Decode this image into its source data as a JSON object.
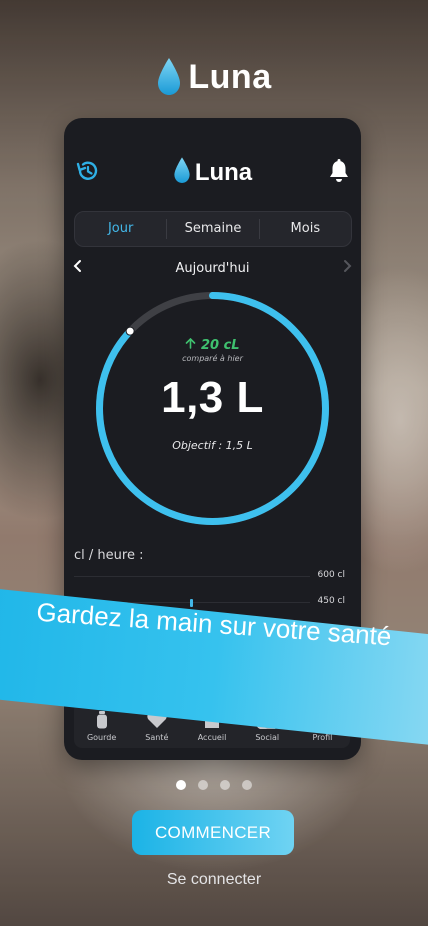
{
  "app": {
    "name": "Luna"
  },
  "preview": {
    "header": {
      "title": "Luna"
    },
    "tabs": [
      {
        "label": "Jour",
        "active": true
      },
      {
        "label": "Semaine",
        "active": false
      },
      {
        "label": "Mois",
        "active": false
      }
    ],
    "date_label": "Aujourd'hui",
    "gauge": {
      "delta": "20 cL",
      "delta_note": "comparé à hier",
      "value": "1,3 L",
      "objective": "Objectif : 1,5 L",
      "progress": 0.87
    },
    "hourly": {
      "title": "cl / heure :",
      "grid_labels": [
        "600 cl",
        "450 cl"
      ]
    },
    "nav": [
      {
        "label": "Gourde",
        "icon": "bottle-icon"
      },
      {
        "label": "Santé",
        "icon": "heart-icon"
      },
      {
        "label": "Accueil",
        "icon": "home-icon"
      },
      {
        "label": "Social",
        "icon": "people-icon"
      },
      {
        "label": "Profil",
        "icon": "profile-icon"
      }
    ]
  },
  "banner": {
    "text": "Gardez la main sur votre santé"
  },
  "pagination": {
    "count": 4,
    "active": 0
  },
  "cta": {
    "label": "COMMENCER"
  },
  "login": {
    "label": "Se connecter"
  },
  "colors": {
    "accent": "#43b7e8",
    "positive": "#3fc16f",
    "phone_bg": "#1b1c21"
  }
}
